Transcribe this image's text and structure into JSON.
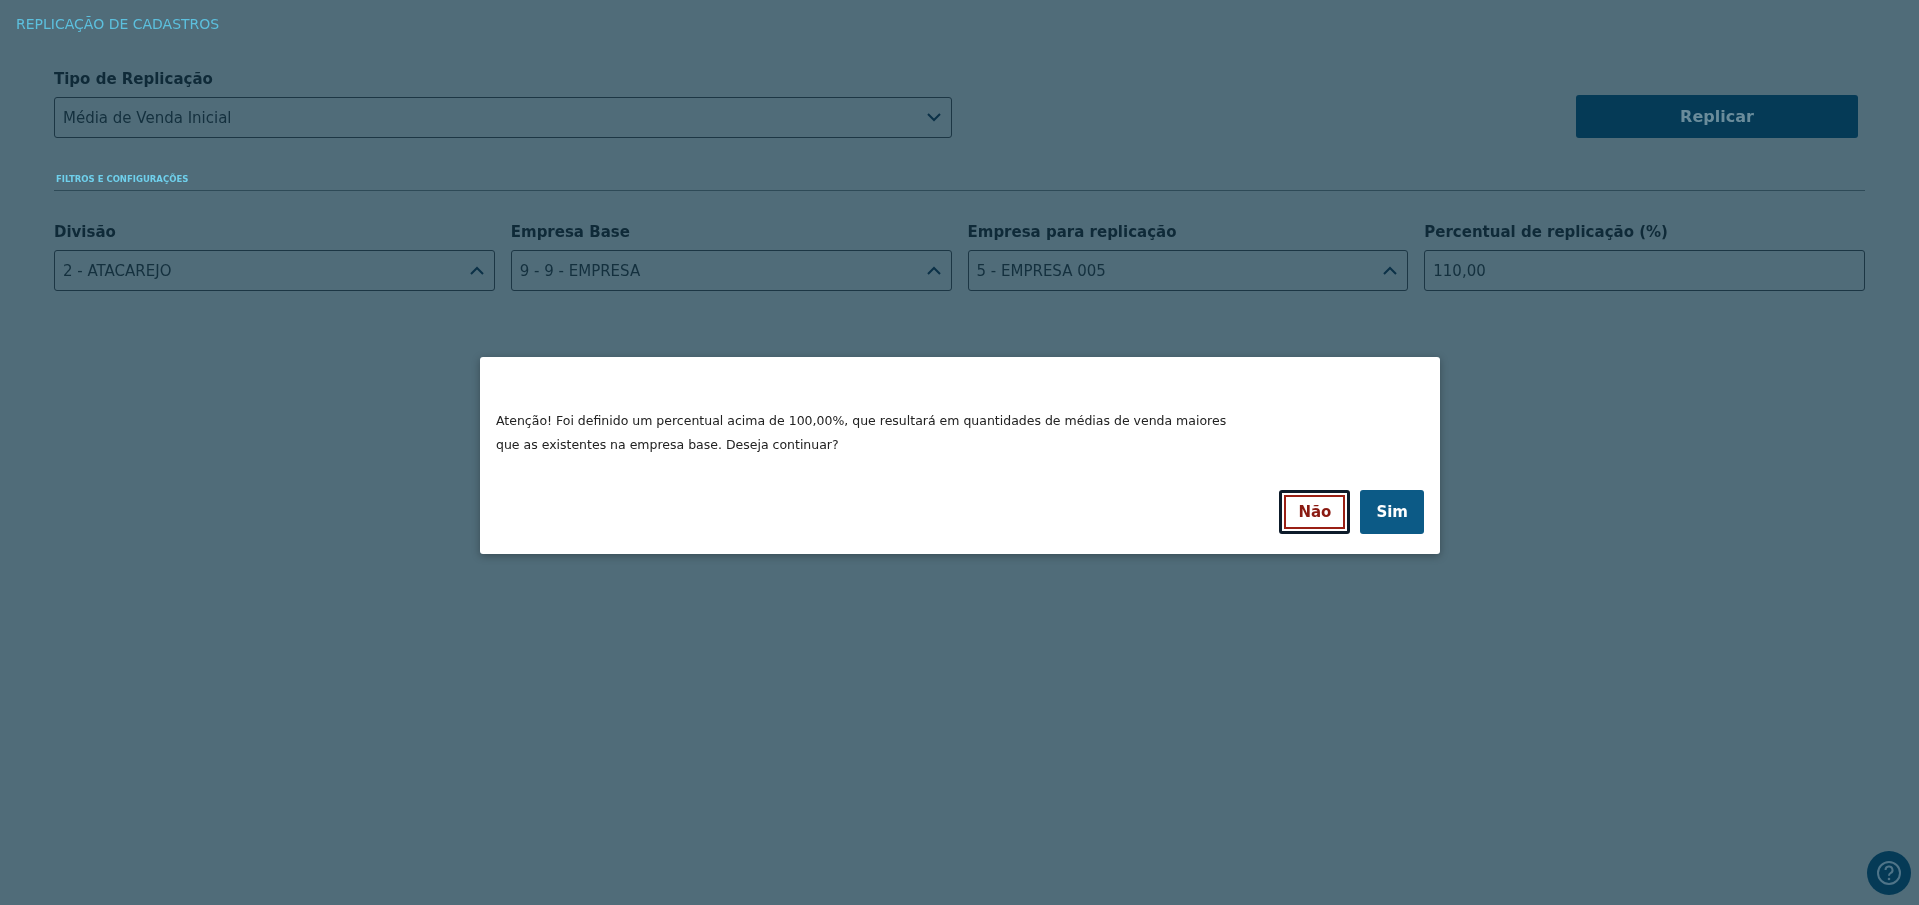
{
  "page_title": "REPLICAÇÃO DE CADASTROS",
  "replication_type": {
    "label": "Tipo de Replicação",
    "value": "Média de Venda Inicial",
    "expanded": false
  },
  "replicate_button": "Replicar",
  "section_title": "FILTROS E CONFIGURAÇÕES",
  "fields": [
    {
      "kind": "select",
      "label": "Divisão",
      "value": "2 - ATACAREJO",
      "expanded": true
    },
    {
      "kind": "select",
      "label": "Empresa Base",
      "value": "9 - 9 - EMPRESA",
      "expanded": true
    },
    {
      "kind": "select",
      "label": "Empresa para replicação",
      "value": "5 - EMPRESA 005",
      "expanded": true
    },
    {
      "kind": "input",
      "label": "Percentual de replicação (%)",
      "value": "110,00"
    }
  ],
  "dialog": {
    "message": "Atenção! Foi definido um percentual acima de 100,00%, que resultará em quantidades de médias de venda maiores que as existentes na empresa base. Deseja continuar?",
    "buttons": [
      {
        "label": "Não",
        "kind": "secondary",
        "focused": true
      },
      {
        "label": "Sim",
        "kind": "primary",
        "focused": false
      }
    ]
  }
}
